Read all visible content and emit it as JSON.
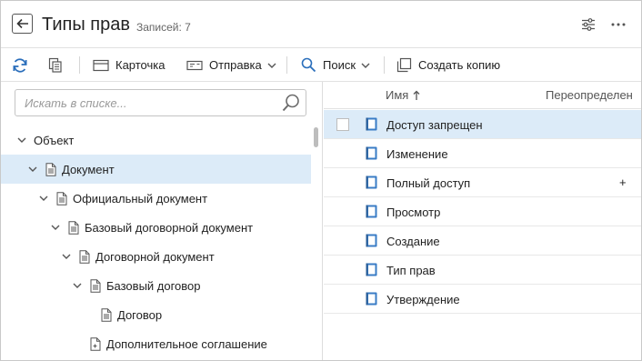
{
  "header": {
    "title": "Типы прав",
    "count_label": "Записей: 7"
  },
  "toolbar": {
    "card_label": "Карточка",
    "send_label": "Отправка",
    "search_label": "Поиск",
    "copy_label": "Создать копию"
  },
  "tree_search": {
    "placeholder": "Искать в списке..."
  },
  "tree": {
    "items": [
      {
        "label": "Объект",
        "level": 0,
        "expanded": true,
        "has_doc_icon": false,
        "selected": false
      },
      {
        "label": "Документ",
        "level": 1,
        "expanded": true,
        "has_doc_icon": true,
        "selected": true
      },
      {
        "label": "Официальный документ",
        "level": 2,
        "expanded": true,
        "has_doc_icon": true,
        "selected": false
      },
      {
        "label": "Базовый договорной документ",
        "level": 3,
        "expanded": true,
        "has_doc_icon": true,
        "selected": false
      },
      {
        "label": "Договорной документ",
        "level": 4,
        "expanded": true,
        "has_doc_icon": true,
        "selected": false
      },
      {
        "label": "Базовый договор",
        "level": 5,
        "expanded": true,
        "has_doc_icon": true,
        "selected": false
      },
      {
        "label": "Договор",
        "level": 6,
        "expanded": null,
        "has_doc_icon": true,
        "selected": false
      },
      {
        "label": "Дополнительное соглашение",
        "level": 5,
        "expanded": null,
        "has_doc_icon": true,
        "selected": false,
        "doc_plus": true
      }
    ]
  },
  "grid": {
    "columns": {
      "name": "Имя",
      "override": "Переопределен"
    },
    "rows": [
      {
        "name": "Доступ запрещен",
        "override": "",
        "selected": true
      },
      {
        "name": "Изменение",
        "override": "",
        "selected": false
      },
      {
        "name": "Полный доступ",
        "override": "+",
        "selected": false
      },
      {
        "name": "Просмотр",
        "override": "",
        "selected": false
      },
      {
        "name": "Создание",
        "override": "",
        "selected": false
      },
      {
        "name": "Тип прав",
        "override": "",
        "selected": false
      },
      {
        "name": "Утверждение",
        "override": "",
        "selected": false
      }
    ]
  },
  "colors": {
    "accent": "#2a6ebb",
    "selection": "#dcebf8",
    "row_icon": "#3a7cc6"
  }
}
